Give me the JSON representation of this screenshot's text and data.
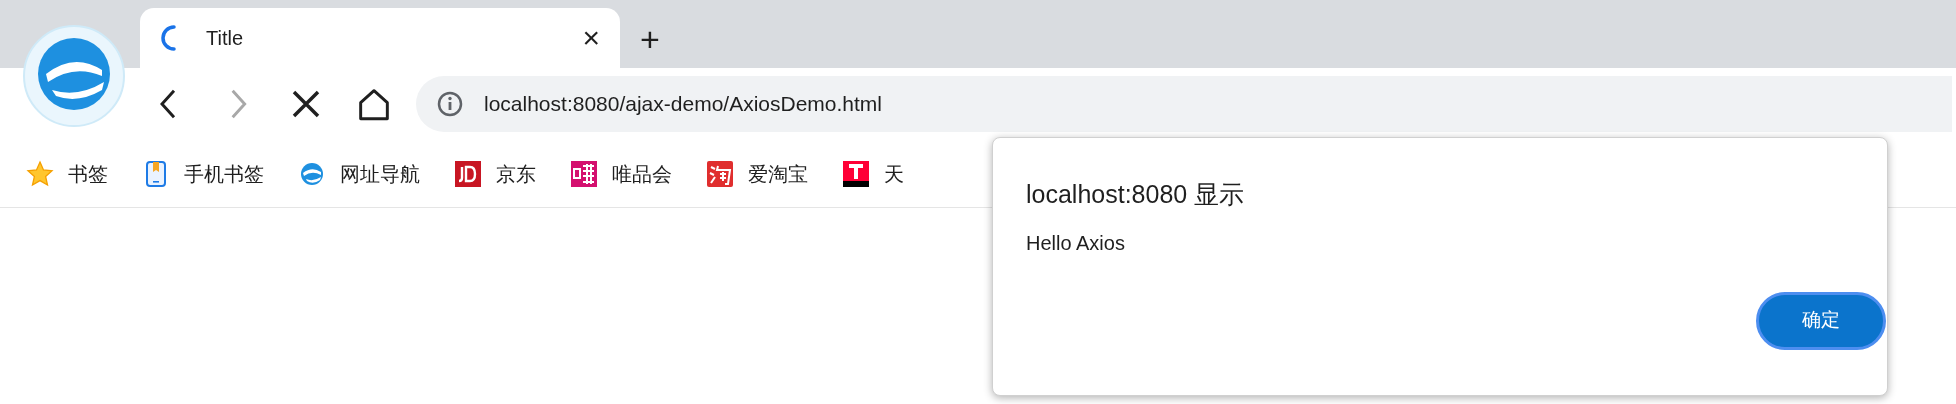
{
  "tab": {
    "title": "Title",
    "close": "×"
  },
  "new_tab": "+",
  "nav_buttons": [
    {
      "kind": "back",
      "disabled": false
    },
    {
      "kind": "forward",
      "disabled": true
    },
    {
      "kind": "stop",
      "disabled": false
    },
    {
      "kind": "home",
      "disabled": false
    }
  ],
  "address_bar": {
    "value": "localhost:8080/ajax-demo/AxiosDemo.html"
  },
  "bookmarks": [
    {
      "kind": "star",
      "label": "书签"
    },
    {
      "kind": "phone",
      "label": "手机书签"
    },
    {
      "kind": "globe",
      "label": "网址导航"
    },
    {
      "kind": "jd",
      "label": "京东"
    },
    {
      "kind": "vip",
      "label": "唯品会"
    },
    {
      "kind": "taobao",
      "label": "爱淘宝"
    },
    {
      "kind": "tmall",
      "label": "天"
    }
  ],
  "dialog": {
    "title": "localhost:8080 显示",
    "message": "Hello Axios",
    "button": "确定"
  }
}
